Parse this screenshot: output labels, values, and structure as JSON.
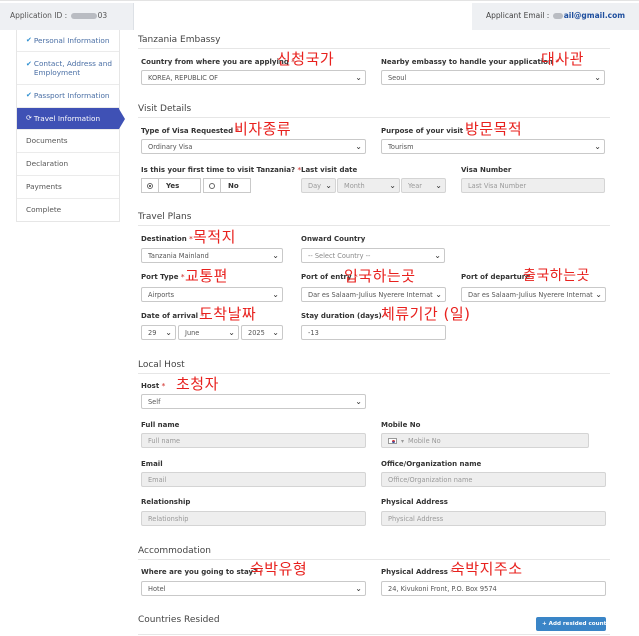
{
  "header": {
    "application_id_label": "Application ID :",
    "application_id_suffix": "03",
    "applicant_email_label": "Applicant Email :",
    "applicant_email_suffix": "ail@gmail.com"
  },
  "sidebar": {
    "items": [
      {
        "label": "Personal Information",
        "state": "done"
      },
      {
        "label": "Contact, Address and Employment",
        "state": "done"
      },
      {
        "label": "Passport Information",
        "state": "done"
      },
      {
        "label": "Travel Information",
        "state": "active"
      },
      {
        "label": "Documents",
        "state": "pending"
      },
      {
        "label": "Declaration",
        "state": "pending"
      },
      {
        "label": "Payments",
        "state": "pending"
      },
      {
        "label": "Complete",
        "state": "pending"
      }
    ]
  },
  "embassy": {
    "title": "Tanzania Embassy",
    "country_label": "Country from where you are applying",
    "country_value": "KOREA, REPUBLIC OF",
    "embassy_label": "Nearby embassy to handle your application",
    "embassy_value": "Seoul"
  },
  "visit": {
    "title": "Visit Details",
    "visa_type_label": "Type of Visa Requested",
    "visa_type_value": "Ordinary Visa",
    "purpose_label": "Purpose of your visit",
    "purpose_value": "Tourism",
    "first_time_label": "Is this your first time to visit Tanzania?",
    "yes": "Yes",
    "no": "No",
    "last_visit_label": "Last visit date",
    "day_ph": "Day",
    "month_ph": "Month",
    "year_ph": "Year",
    "visa_number_label": "Visa Number",
    "visa_number_ph": "Last Visa Number"
  },
  "travel": {
    "title": "Travel Plans",
    "destination_label": "Destination",
    "destination_value": "Tanzania Mainland",
    "onward_label": "Onward Country",
    "onward_value": "-- Select Country --",
    "port_type_label": "Port Type",
    "port_type_value": "Airports",
    "port_entry_label": "Port of entry",
    "port_entry_value": "Dar es Salaam-Julius Nyerere Internat",
    "port_departure_label": "Port of departure",
    "port_departure_value": "Dar es Salaam-Julius Nyerere Internat",
    "arrival_label": "Date of arrival",
    "arrival_day": "29",
    "arrival_month": "June",
    "arrival_year": "2025",
    "stay_label": "Stay duration (days)",
    "stay_value": "-13"
  },
  "host": {
    "title": "Local Host",
    "host_label": "Host",
    "host_value": "Self",
    "full_name_label": "Full name",
    "full_name_ph": "Full name",
    "mobile_label": "Mobile No",
    "mobile_ph": "Mobile No",
    "email_label": "Email",
    "email_ph": "Email",
    "org_label": "Office/Organization name",
    "org_ph": "Office/Organization name",
    "relationship_label": "Relationship",
    "relationship_ph": "Relationship",
    "physical_label": "Physical Address",
    "physical_ph": "Physical Address"
  },
  "accommodation": {
    "title": "Accommodation",
    "stay_where_label": "Where are you going to stay?",
    "stay_where_value": "Hotel",
    "address_label": "Physical Address",
    "address_value": "24, Kivukoni Front, P.O. Box 9574"
  },
  "countries": {
    "title": "Countries Resided",
    "add_button": "+ Add resided country"
  },
  "annotations": {
    "country": "신청국가",
    "embassy": "대사관",
    "visa_type": "비자종류",
    "purpose": "방문목적",
    "destination": "목적지",
    "port_type": "교통편",
    "port_entry": "입국하는곳",
    "port_departure": "출국하는곳",
    "arrival": "도착날짜",
    "stay": "체류기간 (일)",
    "host": "초청자",
    "stay_type": "숙박유형",
    "address": "숙박지주소"
  },
  "colors": {
    "active_nav": "#3f51b5",
    "annotation": "#e8211e",
    "required": "#d9534f",
    "button": "#3a85c7"
  }
}
